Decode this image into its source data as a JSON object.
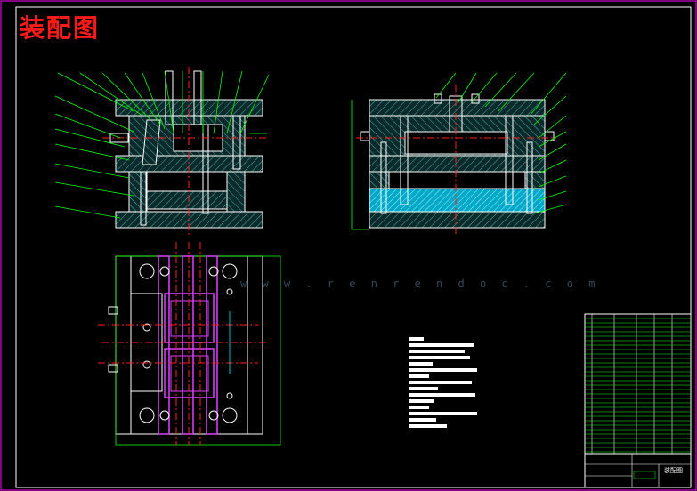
{
  "drawing": {
    "title": "装配图",
    "watermark_url": "w w w . r e n r e n d o c . c o m",
    "title_block_name": "装配图"
  },
  "colors": {
    "background": "#000000",
    "frame": "#ff00ff",
    "outline": "#ffffff",
    "hatch": "#4ab0b0",
    "leader": "#00ff00",
    "center": "#ff2020",
    "highlight": "#00e5ff",
    "part": "#e040ff"
  }
}
